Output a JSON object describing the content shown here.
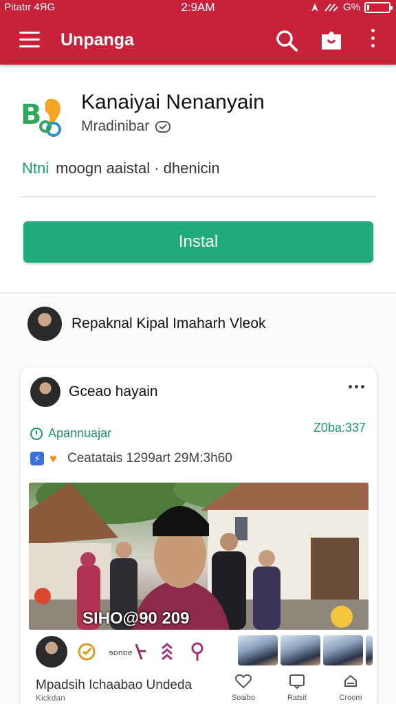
{
  "status_bar": {
    "carrier": "Pitatır 4ЯG",
    "time": "2:9AM",
    "battery_text": "G%",
    "battery_level": 0.1
  },
  "app_bar": {
    "title": "Unpanga",
    "background": "#c8213a",
    "icons": [
      "menu-icon",
      "search-icon",
      "store-icon",
      "more-vert-icon"
    ]
  },
  "app": {
    "name": "Kanaiyai Nenanyain",
    "developer": "Mradinibar",
    "tagline_highlight": "Ntni",
    "tagline": "moogn aaistal · dhenicin",
    "install_label": "Instal",
    "install_color": "#21aa7c"
  },
  "feed": {
    "author_name": "Repaknal Kipal Imaharh Vleok",
    "post": {
      "user": "Gceao hayain",
      "status": "Apannuajar",
      "timestamp": "Z0ba:337",
      "meta": "Ceatatais 1299art 29M:3h60",
      "photo_caption": "SIHO@90 209",
      "footer_text": "Mpadsih Ichaabao Undeda",
      "footer_sub": "Kickdan",
      "actions": [
        "Soaibo",
        "Ratsit",
        "Croom"
      ]
    }
  }
}
